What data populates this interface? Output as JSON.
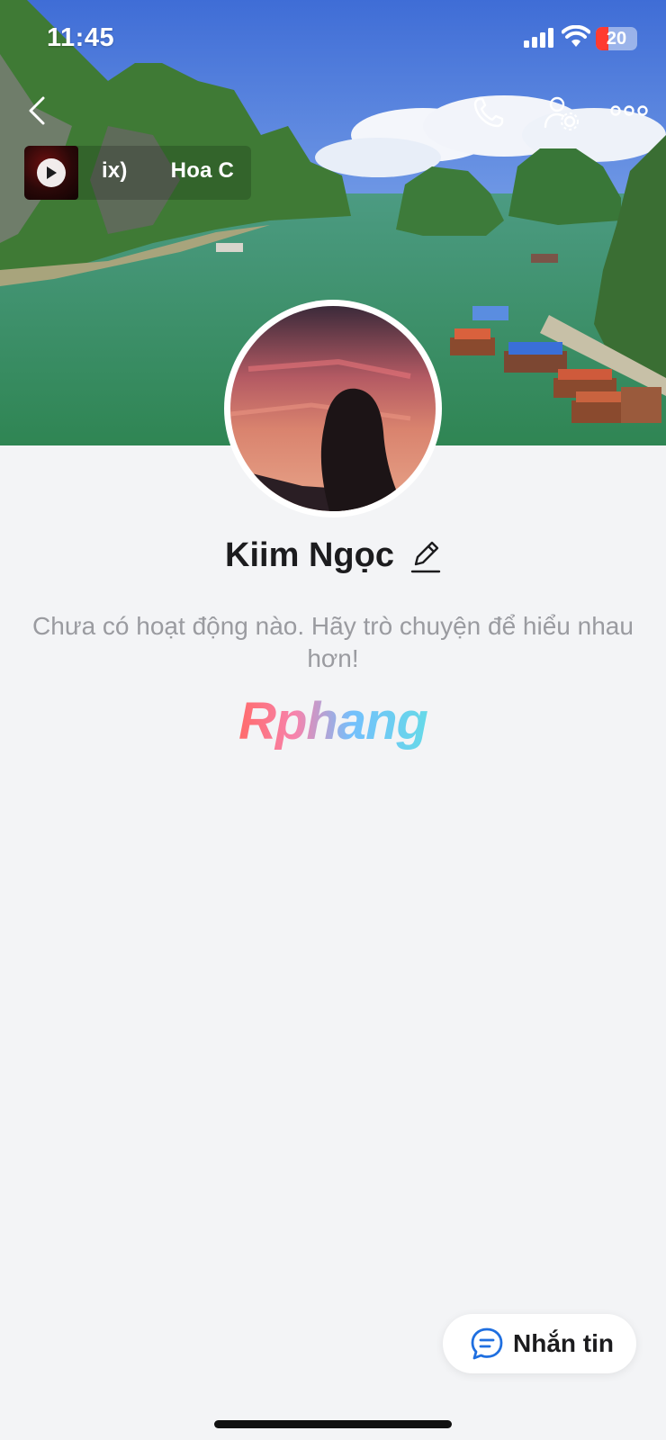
{
  "status_bar": {
    "time": "11:45",
    "battery": "20",
    "signal_icon": "cell-signal-icon",
    "wifi_icon": "wifi-icon"
  },
  "header": {
    "back_icon": "chevron-left-icon",
    "call_icon": "phone-icon",
    "settings_icon": "user-settings-icon",
    "more_icon": "more-horizontal-icon"
  },
  "music": {
    "title": "ix)       Hoa C",
    "play_icon": "play-icon"
  },
  "profile": {
    "name": "Kiim Ngọc",
    "edit_icon": "pencil-icon",
    "description": "Chưa có hoạt động nào. Hãy trò chuyện để hiểu nhau hơn!",
    "watermark": "Rphang"
  },
  "actions": {
    "message_label": "Nhắn tin",
    "message_icon": "chat-bubble-icon"
  },
  "colors": {
    "background": "#f3f4f6",
    "text": "#1c1c1e",
    "muted": "#9a9ba0",
    "accent": "#0068ff"
  }
}
